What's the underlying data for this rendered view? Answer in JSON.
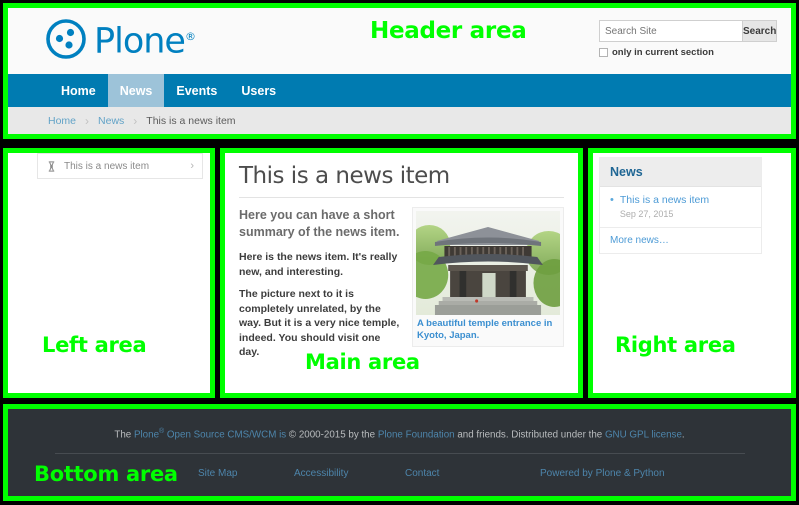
{
  "annotations": {
    "header": "Header area",
    "left": "Left area",
    "main": "Main area",
    "right": "Right area",
    "bottom": "Bottom area",
    "color": "#00ff00"
  },
  "header": {
    "logo_text": "Plone",
    "logo_registered": "®",
    "logo_icon": "plone-logo-icon",
    "search": {
      "placeholder": "Search Site",
      "value": "",
      "button_label": "Search",
      "checkbox_label": "only in current section",
      "checked": false
    },
    "nav": [
      {
        "label": "Home",
        "active": false
      },
      {
        "label": "News",
        "active": true
      },
      {
        "label": "Events",
        "active": false
      },
      {
        "label": "Users",
        "active": false
      }
    ],
    "breadcrumb": {
      "items": [
        "Home",
        "News"
      ],
      "separator": "›",
      "current": "This is a news item"
    }
  },
  "left_panel": {
    "portlet_item_label": "This is a news item",
    "portlet_item_icon": "news-item-icon",
    "portlet_item_arrow": "›"
  },
  "main_panel": {
    "title": "This is a news item",
    "lead": "Here you can have a short summary of the news item.",
    "paragraphs": [
      "Here is the news item. It's really new, and interesting.",
      "The picture next to it is completely unrelated, by the way. But it is a very nice temple, indeed. You should visit one day."
    ],
    "figure_caption": "A beautiful temple entrance in Kyoto, Japan.",
    "figure_alt": "temple-gate-photo"
  },
  "right_panel": {
    "portlet_title": "News",
    "items": [
      {
        "title": "This is a news item",
        "date": "Sep 27, 2015"
      }
    ],
    "more_label": "More news…"
  },
  "footer": {
    "copy_prefix": "The ",
    "copy_plone": "Plone",
    "copy_reg": "®",
    "copy_mid1": " Open Source CMS/WCM is ",
    "copy_c": "©",
    "copy_years": " 2000-2015 by the ",
    "copy_foundation": "Plone Foundation",
    "copy_mid2": " and friends. Distributed under the ",
    "copy_license": "GNU GPL license",
    "copy_end": ".",
    "links": [
      "Site Map",
      "Accessibility",
      "Contact",
      "Powered by Plone & Python"
    ]
  },
  "colors": {
    "plone_blue": "#007bb1",
    "nav_active": "#9dc3d9",
    "link_blue": "#4d9bd6",
    "footer_bg": "#2e3338",
    "annotation_green": "#00ff00"
  }
}
